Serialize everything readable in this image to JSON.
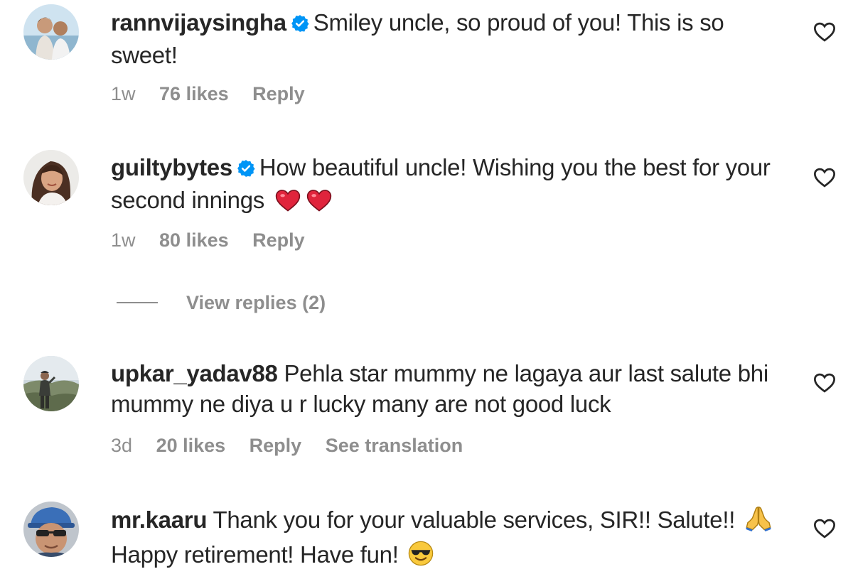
{
  "comments": [
    {
      "username": "rannvijaysingha",
      "verified": true,
      "text": "Smiley uncle, so proud of you! This is so sweet!",
      "time": "1w",
      "likes": "76 likes",
      "reply": "Reply"
    },
    {
      "username": "guiltybytes",
      "verified": true,
      "text": "How beautiful uncle! Wishing you the best for your second innings",
      "time": "1w",
      "likes": "80 likes",
      "reply": "Reply",
      "emoji": [
        "red-heart-emoji",
        "red-heart-emoji"
      ]
    },
    {
      "username": "upkar_yadav88",
      "verified": false,
      "text": "Pehla star mummy ne lagaya aur last salute bhi mummy ne diya u r lucky many are not good luck",
      "time": "3d",
      "likes": "20 likes",
      "reply": "Reply",
      "translation": "See translation"
    },
    {
      "username": "mr.kaaru",
      "verified": false,
      "text_line1": "Thank you for your valuable services, SIR!! Salute!!",
      "text_line2": "Happy retirement! Have fun!",
      "emoji": [
        "folded-hands-emoji",
        "sunglasses-face-emoji"
      ]
    }
  ],
  "view_replies": "View replies (2)",
  "colors": {
    "text": "#262626",
    "secondary": "#8e8e8e",
    "verified": "#0095f6",
    "heart_emoji": "#e0243c"
  },
  "icons": {
    "like": "heart-outline-icon",
    "verified": "verified-badge-icon"
  }
}
